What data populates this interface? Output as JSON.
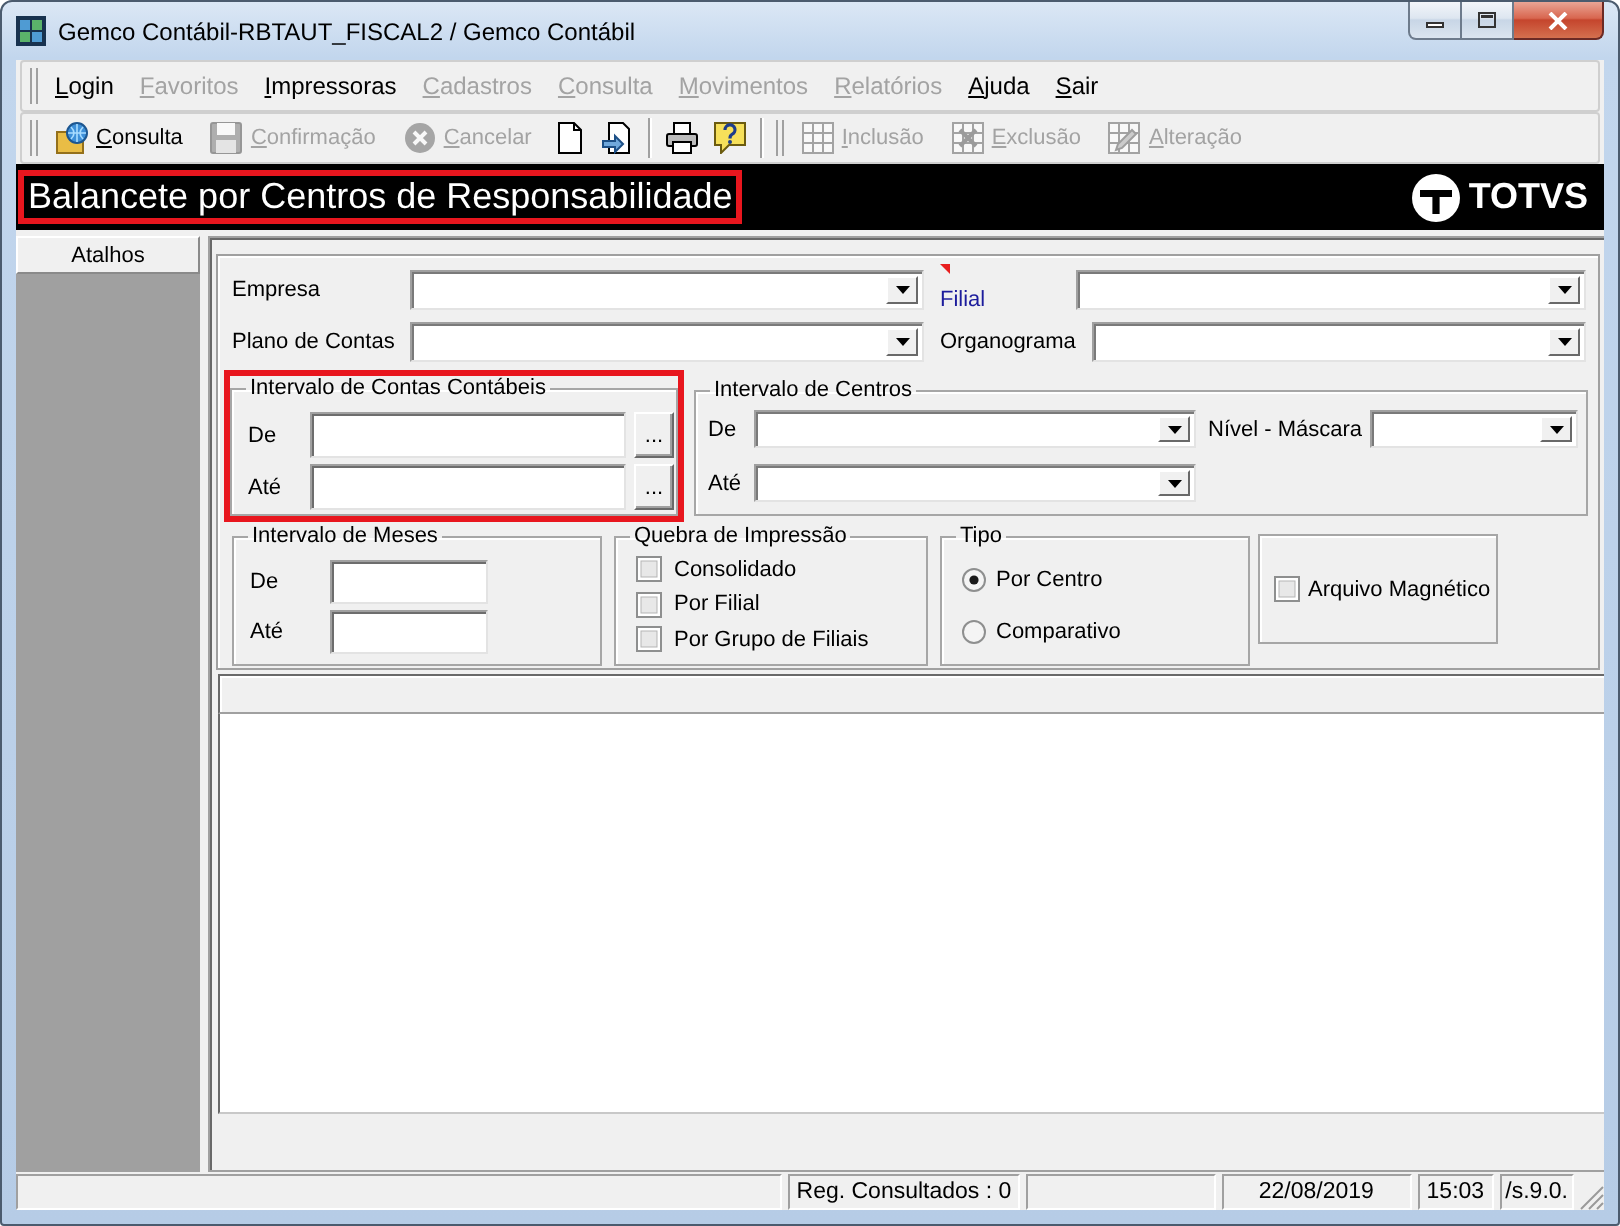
{
  "window": {
    "title": "Gemco Contábil-RBTAUT_FISCAL2 / Gemco Contábil"
  },
  "menu": [
    {
      "label": "Login",
      "disabled": false
    },
    {
      "label": "Favoritos",
      "disabled": true
    },
    {
      "label": "Impressoras",
      "disabled": false
    },
    {
      "label": "Cadastros",
      "disabled": true
    },
    {
      "label": "Consulta",
      "disabled": true
    },
    {
      "label": "Movimentos",
      "disabled": true
    },
    {
      "label": "Relatórios",
      "disabled": true
    },
    {
      "label": "Ajuda",
      "disabled": false
    },
    {
      "label": "Sair",
      "disabled": false
    }
  ],
  "toolbar": [
    {
      "kind": "button",
      "label": "Consulta",
      "disabled": false
    },
    {
      "kind": "button",
      "label": "Confirmação",
      "disabled": true
    },
    {
      "kind": "button",
      "label": "Cancelar",
      "disabled": true
    },
    {
      "kind": "icon",
      "disabled": false
    },
    {
      "kind": "icon",
      "disabled": false
    },
    {
      "kind": "separator"
    },
    {
      "kind": "icon",
      "disabled": false
    },
    {
      "kind": "icon",
      "disabled": false
    },
    {
      "kind": "separator"
    },
    {
      "kind": "gripper"
    },
    {
      "kind": "button",
      "label": "Inclusão",
      "disabled": true
    },
    {
      "kind": "button",
      "label": "Exclusão",
      "disabled": true
    },
    {
      "kind": "button",
      "label": "Alteração",
      "disabled": true
    }
  ],
  "header": {
    "title": "Balancete por Centros de Responsabilidade",
    "highlighted": true,
    "logo": "TOTVS"
  },
  "sidebar": {
    "button": "Atalhos"
  },
  "form": {
    "rows": [
      {
        "fields": [
          {
            "label": "Empresa",
            "required": false
          },
          {
            "label": "Filial",
            "required": true
          }
        ]
      },
      {
        "fields": [
          {
            "label": "Plano de Contas",
            "required": false
          },
          {
            "label": "Organograma",
            "required": false
          }
        ]
      }
    ],
    "contas": {
      "title": "Intervalo de Contas Contábeis",
      "highlighted": true,
      "fields": [
        {
          "label": "De",
          "lookup": "..."
        },
        {
          "label": "Até",
          "lookup": "..."
        }
      ]
    },
    "centros": {
      "title": "Intervalo de Centros",
      "fields": [
        {
          "label": "De"
        },
        {
          "label": "Até"
        }
      ],
      "mask_label": "Nível - Máscara"
    },
    "meses": {
      "title": "Intervalo de Meses",
      "fields": [
        {
          "label": "De"
        },
        {
          "label": "Até"
        }
      ]
    },
    "quebra": {
      "title": "Quebra de Impressão",
      "options": [
        {
          "label": "Consolidado",
          "checked": false
        },
        {
          "label": "Por Filial",
          "checked": false
        },
        {
          "label": "Por Grupo de Filiais",
          "checked": false
        }
      ]
    },
    "tipo": {
      "title": "Tipo",
      "options": [
        {
          "label": "Por Centro",
          "selected": true
        },
        {
          "label": "Comparativo",
          "selected": false
        }
      ]
    },
    "arquivo": {
      "label": "Arquivo Magnético",
      "checked": false
    }
  },
  "status_bar": {
    "records": "Reg. Consultados : 0",
    "date": "22/08/2019",
    "time": "15:03",
    "version": "/s.9.0."
  }
}
